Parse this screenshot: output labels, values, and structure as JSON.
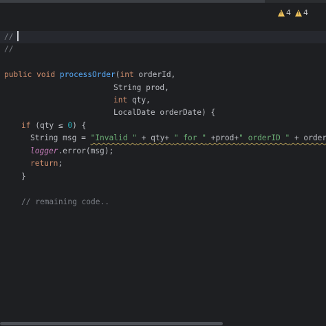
{
  "inspections": {
    "warnings_count": "4",
    "weak_warnings_count": "4"
  },
  "code": {
    "line1": "//",
    "line2": "//",
    "sig1_kw1": "public",
    "sig1_kw2": "void",
    "sig1_fn": "processOrder",
    "sig1_paren": "(",
    "sig1_kw3": "int",
    "sig1_rest": " orderId,",
    "sig2": "String prod,",
    "sig3_kw": "int",
    "sig3_rest": " qty,",
    "sig4": "LocalDate orderDate) {",
    "if_kw": "if",
    "if_open": " (qty ",
    "if_op": "≤",
    "if_num": "0",
    "if_close": ") {",
    "msg_decl": "String msg = ",
    "msg_str1": "\"Invalid \"",
    "msg_mid1": " + qty+ ",
    "msg_str2": "\" for \"",
    "msg_mid2": " +prod+",
    "msg_str3": "\" orderID \"",
    "msg_end": " + orderId;",
    "logger_field": "logger",
    "logger_call": ".error(msg);",
    "return_kw": "return",
    "return_semi": ";",
    "close_brace": "}",
    "comment": "// remaining code.."
  },
  "colors": {
    "background": "#1e1f22",
    "keyword": "#cf8e6d",
    "function": "#56a8f5",
    "string": "#6aab73",
    "number": "#2aacb8",
    "comment": "#7a7e85",
    "warning": "#f2c55c"
  }
}
